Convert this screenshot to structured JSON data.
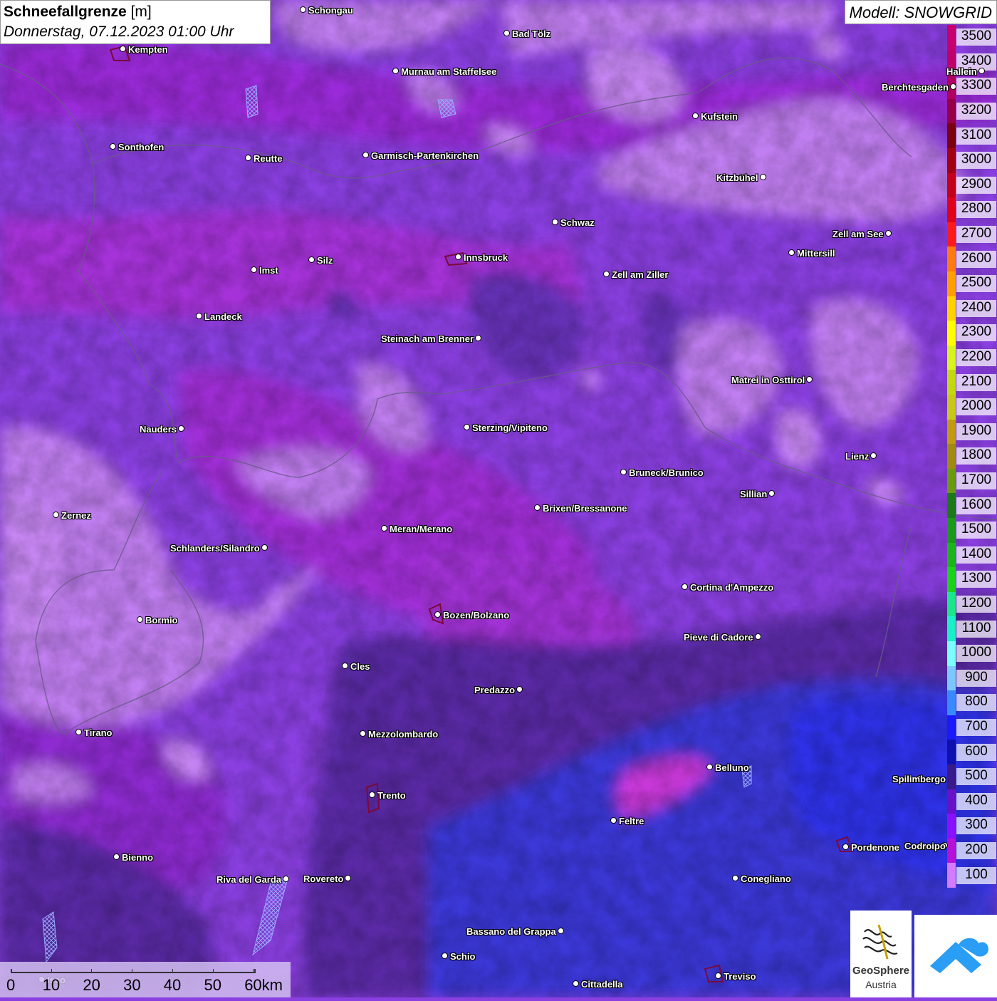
{
  "title": {
    "main": "Schneefallgrenze",
    "unit": "[m]",
    "datetime": "Donnerstag, 07.12.2023 01:00 Uhr"
  },
  "model": "Modell: SNOWGRID",
  "legend": [
    {
      "label": "3500",
      "color": "#c8006e"
    },
    {
      "label": "3400",
      "color": "#c0006a"
    },
    {
      "label": "3300",
      "color": "#b00060"
    },
    {
      "label": "3200",
      "color": "#960048"
    },
    {
      "label": "3100",
      "color": "#7a0010"
    },
    {
      "label": "3000",
      "color": "#a00010"
    },
    {
      "label": "2900",
      "color": "#c40018"
    },
    {
      "label": "2800",
      "color": "#e0001a"
    },
    {
      "label": "2700",
      "color": "#ff1a1a"
    },
    {
      "label": "2600",
      "color": "#ff7a10"
    },
    {
      "label": "2500",
      "color": "#ff9f00"
    },
    {
      "label": "2400",
      "color": "#ffd200"
    },
    {
      "label": "2300",
      "color": "#ffff00"
    },
    {
      "label": "2200",
      "color": "#d6f51e"
    },
    {
      "label": "2100",
      "color": "#c2d810"
    },
    {
      "label": "2000",
      "color": "#c8c81a"
    },
    {
      "label": "1900",
      "color": "#c09a10"
    },
    {
      "label": "1800",
      "color": "#a08a10"
    },
    {
      "label": "1700",
      "color": "#6a9a10"
    },
    {
      "label": "1600",
      "color": "#1a7a1a"
    },
    {
      "label": "1500",
      "color": "#1a9a1a"
    },
    {
      "label": "1400",
      "color": "#1ab51a"
    },
    {
      "label": "1300",
      "color": "#1ad21a"
    },
    {
      "label": "1200",
      "color": "#1ae68a"
    },
    {
      "label": "1100",
      "color": "#1af0c8"
    },
    {
      "label": "1000",
      "color": "#7affff"
    },
    {
      "label": "900",
      "color": "#7ac8ff"
    },
    {
      "label": "800",
      "color": "#3a8aff"
    },
    {
      "label": "700",
      "color": "#1a1aff"
    },
    {
      "label": "600",
      "color": "#1010b0"
    },
    {
      "label": "500",
      "color": "#3a1a8a"
    },
    {
      "label": "400",
      "color": "#6a10c8"
    },
    {
      "label": "300",
      "color": "#8a10ff"
    },
    {
      "label": "200",
      "color": "#b810d8"
    },
    {
      "label": "100",
      "color": "#d67aff"
    }
  ],
  "cities": [
    {
      "name": "Schongau",
      "side": "right"
    },
    {
      "name": "Bad Tölz",
      "side": "right"
    },
    {
      "name": "Kempten",
      "side": "right"
    },
    {
      "name": "Murnau am Staffelsee",
      "side": "right"
    },
    {
      "name": "Hallein",
      "side": "left"
    },
    {
      "name": "Berchtesgaden",
      "side": "left"
    },
    {
      "name": "Kufstein",
      "side": "right"
    },
    {
      "name": "Sonthofen",
      "side": "right"
    },
    {
      "name": "Reutte",
      "side": "right"
    },
    {
      "name": "Garmisch-Partenkirchen",
      "side": "right"
    },
    {
      "name": "Kitzbühel",
      "side": "left"
    },
    {
      "name": "Schwaz",
      "side": "right"
    },
    {
      "name": "Zell am See",
      "side": "left"
    },
    {
      "name": "Mittersill",
      "side": "right"
    },
    {
      "name": "Innsbruck",
      "side": "right"
    },
    {
      "name": "Imst",
      "side": "right"
    },
    {
      "name": "Silz",
      "side": "right"
    },
    {
      "name": "Zell am Ziller",
      "side": "right"
    },
    {
      "name": "Landeck",
      "side": "right"
    },
    {
      "name": "Steinach am Brenner",
      "side": "left"
    },
    {
      "name": "Matrei in Osttirol",
      "side": "left"
    },
    {
      "name": "Nauders",
      "side": "left"
    },
    {
      "name": "Sterzing/Vipiteno",
      "side": "right"
    },
    {
      "name": "Lienz",
      "side": "left"
    },
    {
      "name": "Bruneck/Brunico",
      "side": "right"
    },
    {
      "name": "Sillian",
      "side": "left"
    },
    {
      "name": "Zernez",
      "side": "right"
    },
    {
      "name": "Brixen/Bressanone",
      "side": "right"
    },
    {
      "name": "Meran/Merano",
      "side": "right"
    },
    {
      "name": "Schlanders/Silandro",
      "side": "left"
    },
    {
      "name": "Cortina d'Ampezzo",
      "side": "right"
    },
    {
      "name": "Bozen/Bolzano",
      "side": "right"
    },
    {
      "name": "Bormio",
      "side": "right"
    },
    {
      "name": "Pieve di Cadore",
      "side": "left"
    },
    {
      "name": "Cles",
      "side": "right"
    },
    {
      "name": "Predazzo",
      "side": "left"
    },
    {
      "name": "Tirano",
      "side": "right"
    },
    {
      "name": "Mezzolombardo",
      "side": "right"
    },
    {
      "name": "Belluno",
      "side": "right"
    },
    {
      "name": "Spilimbergo",
      "side": "right"
    },
    {
      "name": "Trento",
      "side": "right"
    },
    {
      "name": "Feltre",
      "side": "right"
    },
    {
      "name": "Pordenone",
      "side": "right"
    },
    {
      "name": "Codroipo",
      "side": "right"
    },
    {
      "name": "Bienno",
      "side": "right"
    },
    {
      "name": "Riva del Garda",
      "side": "left"
    },
    {
      "name": "Rovereto",
      "side": "left"
    },
    {
      "name": "Conegliano",
      "side": "right"
    },
    {
      "name": "Bassano del Grappa",
      "side": "left"
    },
    {
      "name": "Schio",
      "side": "right"
    },
    {
      "name": "Treviso",
      "side": "right"
    },
    {
      "name": "Cittadella",
      "side": "right"
    },
    {
      "name": "Iseo",
      "side": "right"
    }
  ],
  "scale": {
    "ticks": [
      "0",
      "10",
      "20",
      "30",
      "40",
      "50",
      "60km"
    ]
  },
  "logo": {
    "name": "GeoSphere",
    "sub": "Austria"
  }
}
